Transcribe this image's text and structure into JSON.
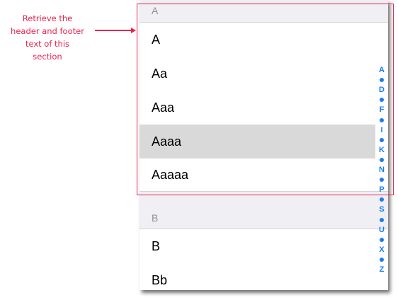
{
  "annotation": {
    "lines": [
      "Retrieve the",
      "header and footer",
      "text of this",
      "section"
    ],
    "color": "#e8234f"
  },
  "sections": [
    {
      "header": "A",
      "rows": [
        "A",
        "Aa",
        "Aaa",
        "Aaaa",
        "Aaaaa"
      ],
      "selected_row": "Aaaa"
    },
    {
      "header": "B",
      "rows": [
        "B",
        "Bb"
      ]
    }
  ],
  "index": [
    "A",
    "•",
    "D",
    "•",
    "F",
    "•",
    "I",
    "•",
    "K",
    "•",
    "N",
    "•",
    "P",
    "•",
    "S",
    "•",
    "U",
    "•",
    "X",
    "•",
    "Z"
  ],
  "colors": {
    "accent": "#1a7cf5",
    "header_bg": "#efeff4",
    "selected_bg": "#d9d9d9"
  }
}
